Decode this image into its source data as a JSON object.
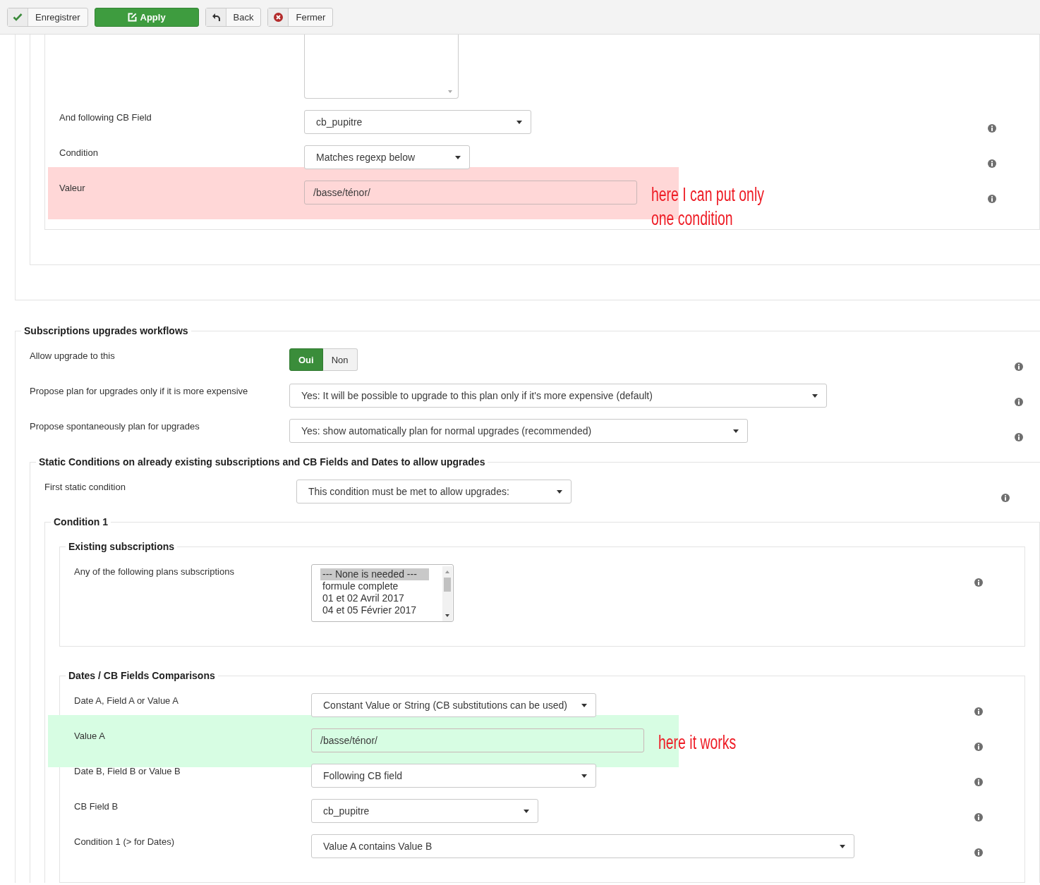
{
  "toolbar": {
    "buttons": [
      {
        "kind": "save",
        "label": "Enregistrer"
      },
      {
        "kind": "apply",
        "label": "Apply"
      },
      {
        "kind": "back",
        "label": "Back"
      },
      {
        "kind": "close",
        "label": "Fermer"
      }
    ]
  },
  "cb_fields": {
    "rows": [
      {
        "label": "And following CB Field",
        "kind": "select",
        "value": "cb_pupitre"
      },
      {
        "label": "Condition",
        "kind": "select",
        "value": "Matches regexp below"
      },
      {
        "label": "Valeur",
        "kind": "input",
        "value": "/basse/ténor/",
        "highlight": {
          "color": "#ffd7d7",
          "note": "here I can put only one condition"
        }
      }
    ]
  },
  "upgrades_workflows": {
    "title": "Subscriptions upgrades workflows",
    "rows": [
      {
        "label": "Allow upgrade to this",
        "kind": "toggle",
        "options": [
          {
            "label": "Oui",
            "selected": true
          },
          {
            "label": "Non",
            "selected": false
          }
        ]
      },
      {
        "label": "Propose plan for upgrades only if it is more expensive",
        "kind": "select",
        "value": "Yes: It will be possible to upgrade to this plan only if it's more expensive (default)"
      },
      {
        "label": "Propose spontaneously plan for upgrades",
        "kind": "select",
        "value": "Yes: show automatically plan for normal upgrades (recommended)"
      }
    ]
  },
  "static_conditions": {
    "title": "Static Conditions on already existing subscriptions and CB Fields and Dates to allow upgrades",
    "rows": [
      {
        "label": "First static condition",
        "kind": "select",
        "value": "This condition must be met to allow upgrades:"
      }
    ],
    "condition": {
      "title": "Condition 1",
      "groups": [
        {
          "title": "Existing subscriptions",
          "rows": [
            {
              "label": "Any of the following plans subscriptions",
              "kind": "listbox",
              "options": [
                {
                  "label": "--- None is needed ---",
                  "selected": true
                },
                {
                  "label": "formule complete",
                  "selected": false
                },
                {
                  "label": "01 et 02 Avril 2017",
                  "selected": false
                },
                {
                  "label": "04 et 05 Février 2017",
                  "selected": false
                }
              ]
            }
          ]
        },
        {
          "title": "Dates / CB Fields Comparisons",
          "rows": [
            {
              "label": "Date A, Field A or Value A",
              "kind": "select",
              "value": "Constant Value or String (CB substitutions can be used)"
            },
            {
              "label": "Value A",
              "kind": "input",
              "value": "/basse/ténor/",
              "highlight": {
                "color": "#d7fde3",
                "note": "here it works"
              }
            },
            {
              "label": "Date B, Field B or Value B",
              "kind": "select",
              "value": "Following CB field"
            },
            {
              "label": "CB Field B",
              "kind": "select",
              "value": "cb_pupitre"
            },
            {
              "label": "Condition 1 (> for Dates)",
              "kind": "select",
              "value": "Value A contains Value B"
            }
          ]
        }
      ]
    }
  }
}
